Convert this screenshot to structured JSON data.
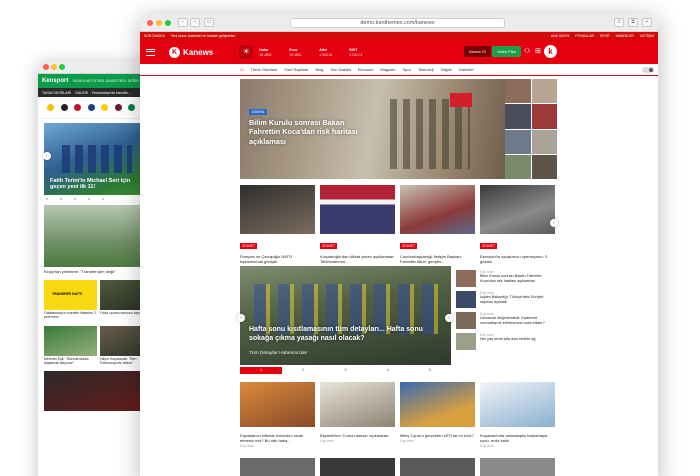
{
  "back_window": {
    "logo": "Kensport",
    "nav": "YAZARLAR FUTBOL BASKETBOL DİĞER",
    "subbar": [
      "TAKIM SKORLARI",
      "GALERİ",
      "Fenerbahçe'de transfer..."
    ],
    "hero_title": "Fatih Terim'in Michael Seri için geçen yeni ilk 11!",
    "card2_title": "Klopp'tan yönetime: \"Transfer işim değil\"",
    "tile1_label": "TRANSFER HATTI",
    "tiles": [
      {
        "caption": "Galatasaray'ın transfer listesine 2 yeni isim!"
      },
      {
        "caption": "Yıldız oyuncu sezonu kapattı"
      },
      {
        "caption": "Mehmet Eşit: \"Sezona iddialı başlamak istiyoruz\""
      },
      {
        "caption": "Yalçın Koşukavak: \"Ben Trabzonsporlu oldum\""
      }
    ]
  },
  "browser": {
    "url": "demo.kanthemes.com/kanews"
  },
  "topbar": [
    "SON DAKİKA",
    "Yeni sezon haberleri ve transfer gelişmeleri",
    "ANA SAYFA",
    "PİYASALAR",
    "SPOR",
    "HABERLER",
    "İLETİŞİM"
  ],
  "header": {
    "logo": "Kanews",
    "logo_letter": "K",
    "weather_icon": "sun-icon",
    "markets": [
      {
        "name": "Dolar",
        "value": "18,4892"
      },
      {
        "name": "Euro",
        "value": "19,4821"
      },
      {
        "name": "Altın",
        "value": "1.060,01"
      },
      {
        "name": "BIST",
        "value": "3.284,74"
      }
    ],
    "login_label": "Abone Ol",
    "live_label": "Video Film",
    "badge_letter": "k"
  },
  "nav": {
    "home_icon": "home-icon",
    "items": [
      "Tüme Gündem",
      "Özel Sayfalar",
      "Blog",
      "Son Dakika",
      "Ekonomi",
      "Magazin",
      "Spor",
      "Teknoloji",
      "Sağlık",
      "Galeriler"
    ]
  },
  "hero": {
    "badge": "DÜNYA",
    "title": "Bilim Kurulu sonrası Bakan Fahrettin Koca'dan risk haritası açıklaması"
  },
  "cards": [
    {
      "category": "SİYASET",
      "title": "Pompeo ve Çavuşoğlu NATO toplantısında görüştü"
    },
    {
      "category": "SİYASET",
      "title": "Kılıçdaroğlu'dan dikkat çeken açıklamalar: Telefonlarımın..."
    },
    {
      "category": "SİYASET",
      "title": "Cumhurbaşkanlığı İletişim Başkanı Fahrettin Altun, gençler..."
    },
    {
      "category": "SİYASET",
      "title": "Esenyurt'ta uyuşturucu operasyonu: 3 gözaltı"
    }
  ],
  "featured": {
    "title": "Hafta sonu kısıtlamasının tüm detayları... Hafta sonu sokağa çıkma yasağı nasıl olacak?",
    "subtitle": "Tüm Detaylar Haberimizde!",
    "pages": [
      "1",
      "2",
      "3",
      "4",
      "5"
    ]
  },
  "sidebar": [
    {
      "date": "8 ay önce",
      "title": "Bilim Kurulu sonrası Bakan Fahrettin Koca'dan risk haritası açıklaması"
    },
    {
      "date": "8 ay önce",
      "title": "İçişleri Bakanlığı, Türkiye'deki Suriyeli sayısını açıkladı"
    },
    {
      "date": "8 ay önce",
      "title": "Uzmanlar değerlendirdi: Kademeli normalleşme ertelenmesi nasıl etkiler?"
    },
    {
      "date": "8 ay önce",
      "title": "Her yaş bizim şifa dolu birlikte ağ"
    }
  ],
  "grid": [
    {
      "title": "Faydalanıcı bilisiniz evinizden olcak etmeniz miz? Bu ottu haba...",
      "date": "8 ay önce"
    },
    {
      "title": "Ekyanet'ten 'Cuma namazı' açıklaması",
      "date": "8 ay önce"
    },
    {
      "title": "Miley Cyrus'u gerçekten UFO'lar mı kırık?",
      "date": "8 ay önce"
    },
    {
      "title": "Kuşadası'nda vatandaşlar kısıtlamaya uydu, evde kaldı",
      "date": "8 ay önce"
    }
  ]
}
